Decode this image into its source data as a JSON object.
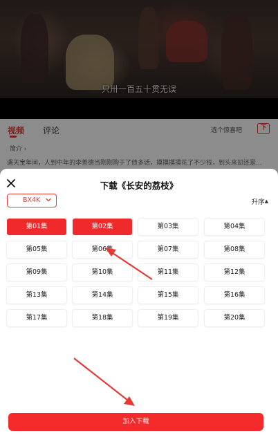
{
  "video": {
    "subtitle": "只卅一百五十贯无误"
  },
  "tabs": [
    {
      "label": "视频",
      "active": true
    },
    {
      "label": "评论",
      "active": false
    }
  ],
  "episode_selector": "选个惊喜吧",
  "download_icon_label": "下",
  "intro_label": "简介 ›",
  "synopsis": "遇天宝年间，人到中年的李善德当刚刚购于了债多话，摸摸摸摸花了不少钱，到头来却还是...",
  "sheet": {
    "title": "下载《长安的荔枝》",
    "quality": "BX4K",
    "sort_label": "升序",
    "sort_arrow": "▲",
    "episodes": [
      {
        "label": "第01集",
        "selected": true
      },
      {
        "label": "第02集",
        "selected": true
      },
      {
        "label": "第03集",
        "selected": false
      },
      {
        "label": "第04集",
        "selected": false
      },
      {
        "label": "第05集",
        "selected": false
      },
      {
        "label": "第06集",
        "selected": false
      },
      {
        "label": "第07集",
        "selected": false
      },
      {
        "label": "第08集",
        "selected": false
      },
      {
        "label": "第09集",
        "selected": false
      },
      {
        "label": "第10集",
        "selected": false
      },
      {
        "label": "第11集",
        "selected": false
      },
      {
        "label": "第12集",
        "selected": false
      },
      {
        "label": "第13集",
        "selected": false
      },
      {
        "label": "第14集",
        "selected": false
      },
      {
        "label": "第15集",
        "selected": false
      },
      {
        "label": "第16集",
        "selected": false
      },
      {
        "label": "第17集",
        "selected": false
      },
      {
        "label": "第18集",
        "selected": false
      },
      {
        "label": "第19集",
        "selected": false
      },
      {
        "label": "第20集",
        "selected": false
      }
    ],
    "submit_label": "加入下载"
  },
  "colors": {
    "accent": "#e53935",
    "selected": "#ee2a2a",
    "button": "#f52a2a"
  }
}
